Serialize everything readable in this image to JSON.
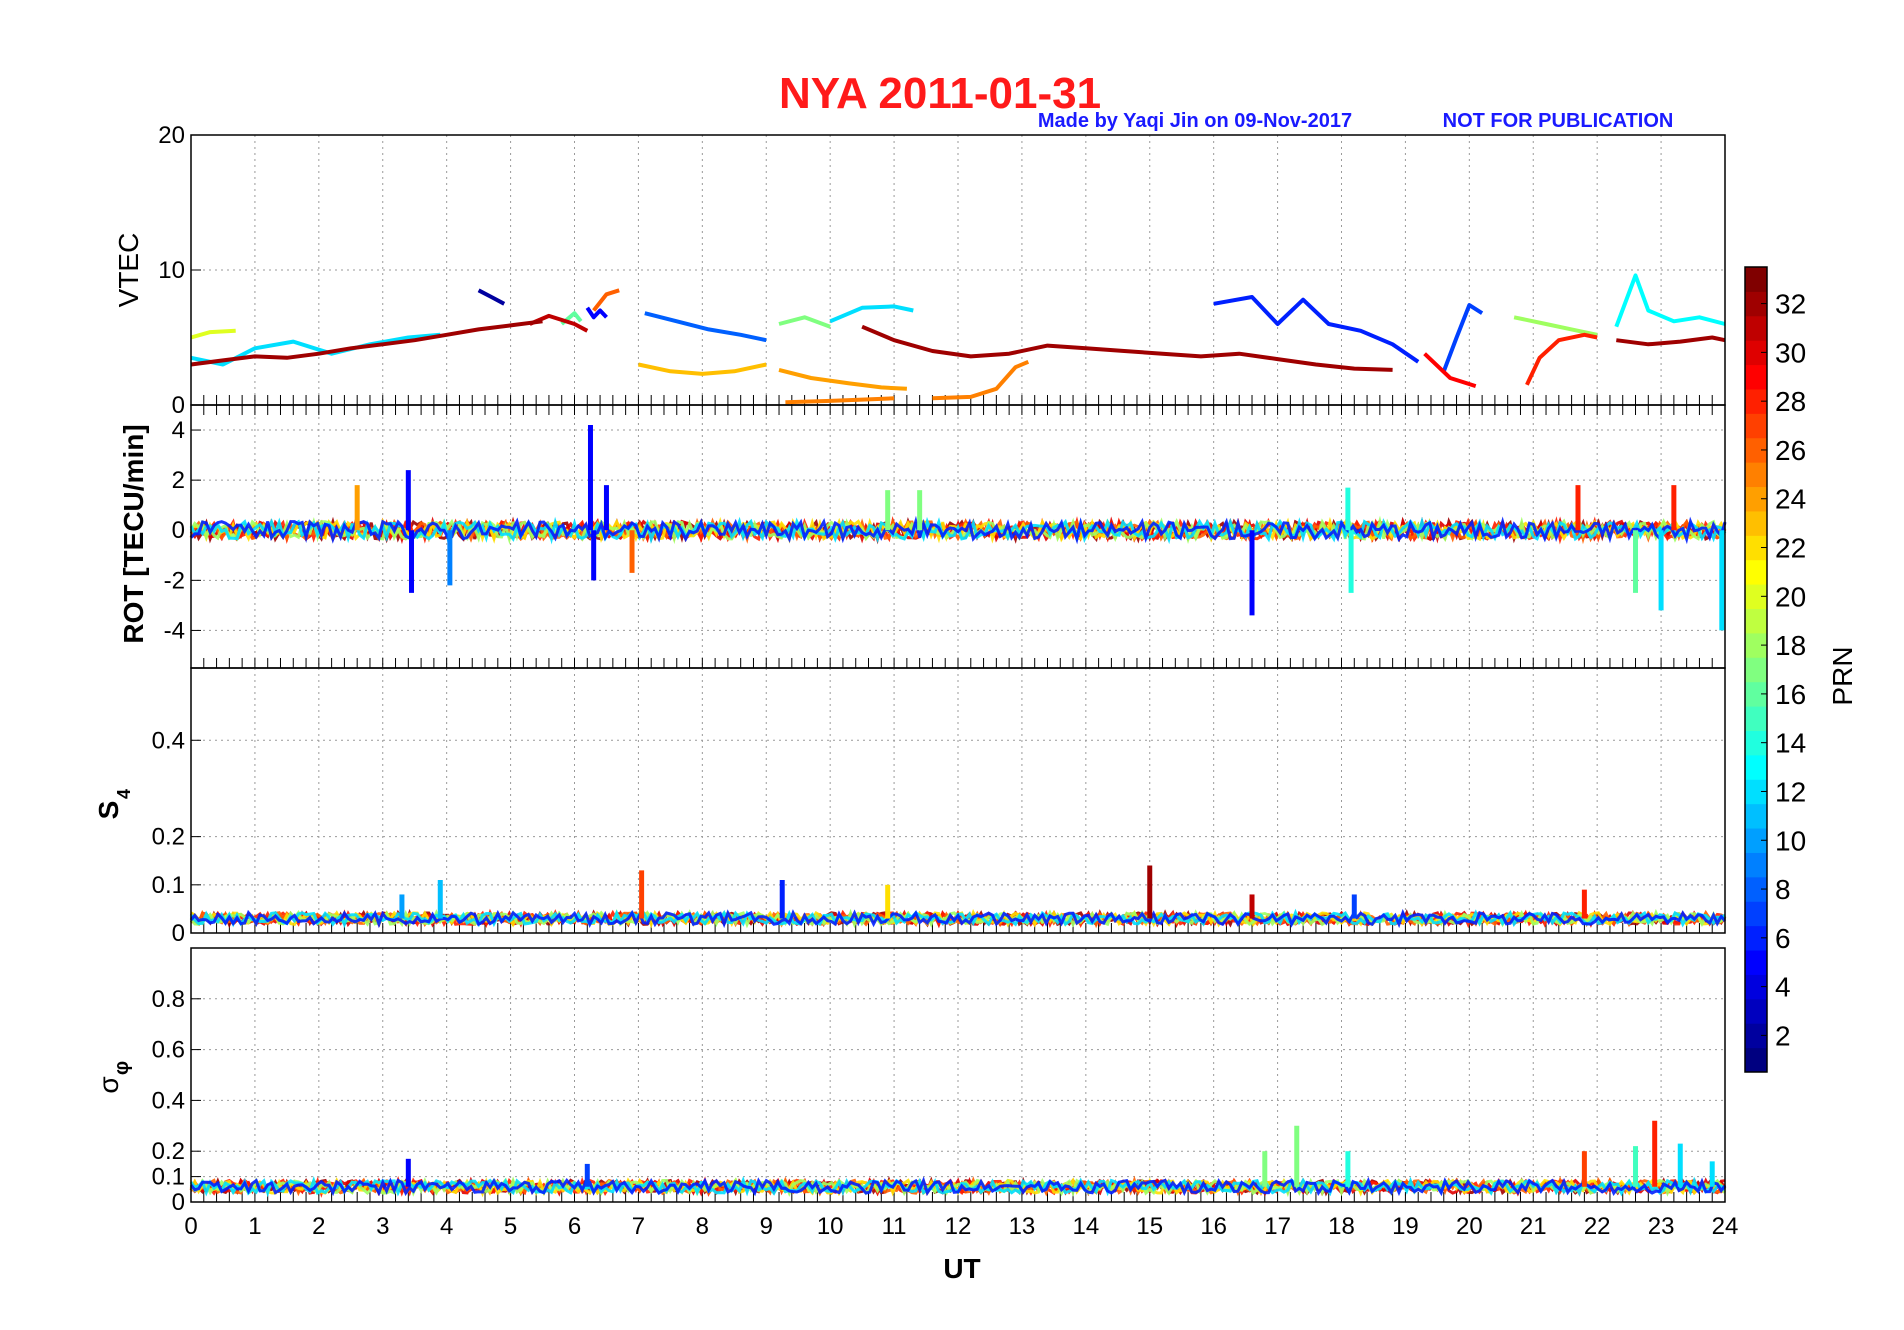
{
  "title": "NYA   2011-01-31",
  "credit": "Made by Yaqi Jin on 09-Nov-2017",
  "notice": "NOT FOR PUBLICATION",
  "colors": {
    "title": "#ff1a1a",
    "credit": "#1a1aff"
  },
  "chart_data": {
    "type": "line",
    "x": {
      "label": "UT",
      "range": [
        0,
        24
      ],
      "ticks": [
        "0",
        "1",
        "2",
        "3",
        "4",
        "5",
        "6",
        "7",
        "8",
        "9",
        "10",
        "11",
        "12",
        "13",
        "14",
        "15",
        "16",
        "17",
        "18",
        "19",
        "20",
        "21",
        "22",
        "23",
        "24"
      ]
    },
    "grid": true,
    "colorbar": {
      "label": "PRN",
      "range": [
        1,
        33
      ],
      "ticks": [
        "2",
        "4",
        "6",
        "8",
        "10",
        "12",
        "14",
        "16",
        "18",
        "20",
        "22",
        "24",
        "26",
        "28",
        "30",
        "32"
      ],
      "colormap": "jet"
    },
    "panels": [
      {
        "ylabel": "VTEC",
        "ylim": [
          0,
          20
        ],
        "yticks": [
          "0",
          "10",
          "20"
        ],
        "series": [
          {
            "prn": 2,
            "points": [
              [
                4.5,
                8.5
              ],
              [
                4.7,
                8.0
              ],
              [
                4.9,
                7.5
              ]
            ]
          },
          {
            "prn": 5,
            "points": [
              [
                6.2,
                7.2
              ],
              [
                6.3,
                6.5
              ],
              [
                6.4,
                7.0
              ],
              [
                6.5,
                6.5
              ]
            ]
          },
          {
            "prn": 6,
            "points": [
              [
                16,
                7.5
              ],
              [
                16.6,
                8.0
              ],
              [
                17,
                6.0
              ],
              [
                17.4,
                7.8
              ],
              [
                17.8,
                6.0
              ],
              [
                18.3,
                5.5
              ],
              [
                18.8,
                4.5
              ],
              [
                19.2,
                3.2
              ]
            ]
          },
          {
            "prn": 7,
            "points": [
              [
                19.6,
                2.5
              ],
              [
                19.8,
                5.0
              ],
              [
                20.0,
                7.4
              ],
              [
                20.2,
                6.8
              ]
            ]
          },
          {
            "prn": 8,
            "points": [
              [
                7.1,
                6.8
              ],
              [
                7.6,
                6.2
              ],
              [
                8.1,
                5.6
              ],
              [
                8.6,
                5.2
              ],
              [
                9.0,
                4.8
              ]
            ]
          },
          {
            "prn": 12,
            "points": [
              [
                10.0,
                6.2
              ],
              [
                10.5,
                7.2
              ],
              [
                11.0,
                7.3
              ],
              [
                11.3,
                7.0
              ]
            ]
          },
          {
            "prn": 12,
            "points": [
              [
                0.0,
                3.5
              ],
              [
                0.5,
                3.0
              ],
              [
                1.0,
                4.2
              ],
              [
                1.6,
                4.7
              ],
              [
                2.2,
                3.8
              ],
              [
                2.8,
                4.5
              ],
              [
                3.4,
                5.0
              ],
              [
                3.9,
                5.2
              ]
            ]
          },
          {
            "prn": 13,
            "points": [
              [
                22.3,
                5.8
              ],
              [
                22.6,
                9.6
              ],
              [
                22.8,
                7.0
              ],
              [
                23.2,
                6.2
              ],
              [
                23.6,
                6.5
              ],
              [
                24.0,
                6.0
              ]
            ]
          },
          {
            "prn": 16,
            "points": [
              [
                5.8,
                6.0
              ],
              [
                6.0,
                6.8
              ],
              [
                6.1,
                6.2
              ]
            ]
          },
          {
            "prn": 17,
            "points": [
              [
                9.2,
                6.0
              ],
              [
                9.6,
                6.5
              ],
              [
                10.0,
                5.8
              ]
            ]
          },
          {
            "prn": 18,
            "points": [
              [
                20.7,
                6.5
              ],
              [
                21.2,
                6.0
              ],
              [
                21.6,
                5.6
              ],
              [
                22.0,
                5.2
              ]
            ]
          },
          {
            "prn": 20,
            "points": [
              [
                0.0,
                5.0
              ],
              [
                0.3,
                5.4
              ],
              [
                0.7,
                5.5
              ]
            ]
          },
          {
            "prn": 23,
            "points": [
              [
                7.0,
                3.0
              ],
              [
                7.5,
                2.5
              ],
              [
                8.0,
                2.3
              ],
              [
                8.5,
                2.5
              ],
              [
                9.0,
                3.0
              ]
            ]
          },
          {
            "prn": 24,
            "points": [
              [
                9.2,
                2.6
              ],
              [
                9.7,
                2.0
              ],
              [
                10.3,
                1.6
              ],
              [
                10.8,
                1.3
              ],
              [
                11.2,
                1.2
              ]
            ]
          },
          {
            "prn": 25,
            "points": [
              [
                9.3,
                0.2
              ],
              [
                10.0,
                0.3
              ],
              [
                10.5,
                0.4
              ],
              [
                11.0,
                0.5
              ]
            ]
          },
          {
            "prn": 25,
            "points": [
              [
                11.6,
                0.5
              ],
              [
                12.2,
                0.6
              ],
              [
                12.6,
                1.2
              ],
              [
                12.9,
                2.8
              ],
              [
                13.1,
                3.2
              ]
            ]
          },
          {
            "prn": 26,
            "points": [
              [
                6.3,
                7.0
              ],
              [
                6.5,
                8.2
              ],
              [
                6.7,
                8.5
              ]
            ]
          },
          {
            "prn": 28,
            "points": [
              [
                20.9,
                1.5
              ],
              [
                21.1,
                3.5
              ],
              [
                21.4,
                4.8
              ],
              [
                21.8,
                5.2
              ],
              [
                22.0,
                5.0
              ]
            ]
          },
          {
            "prn": 29,
            "points": [
              [
                19.3,
                3.8
              ],
              [
                19.7,
                2.0
              ],
              [
                20.1,
                1.4
              ]
            ]
          },
          {
            "prn": 31,
            "points": [
              [
                5.3,
                6.0
              ],
              [
                5.6,
                6.6
              ],
              [
                6.0,
                6.0
              ],
              [
                6.2,
                5.5
              ]
            ]
          },
          {
            "prn": 32,
            "points": [
              [
                0.0,
                3.0
              ],
              [
                0.5,
                3.3
              ],
              [
                1.0,
                3.6
              ],
              [
                1.5,
                3.5
              ],
              [
                2.0,
                3.8
              ],
              [
                2.5,
                4.2
              ],
              [
                3.0,
                4.5
              ],
              [
                3.5,
                4.8
              ],
              [
                4.0,
                5.2
              ],
              [
                4.5,
                5.6
              ],
              [
                5.0,
                5.9
              ],
              [
                5.5,
                6.2
              ]
            ]
          },
          {
            "prn": 32,
            "points": [
              [
                10.5,
                5.8
              ],
              [
                11.0,
                4.8
              ],
              [
                11.6,
                4.0
              ],
              [
                12.2,
                3.6
              ],
              [
                12.8,
                3.8
              ],
              [
                13.4,
                4.4
              ],
              [
                14.0,
                4.2
              ],
              [
                14.6,
                4.0
              ],
              [
                15.2,
                3.8
              ],
              [
                15.8,
                3.6
              ],
              [
                16.4,
                3.8
              ],
              [
                17.0,
                3.4
              ],
              [
                17.6,
                3.0
              ],
              [
                18.2,
                2.7
              ],
              [
                18.8,
                2.6
              ]
            ]
          },
          {
            "prn": 32,
            "points": [
              [
                22.3,
                4.8
              ],
              [
                22.8,
                4.5
              ],
              [
                23.3,
                4.7
              ],
              [
                23.8,
                5.0
              ],
              [
                24.0,
                4.8
              ]
            ]
          }
        ]
      },
      {
        "ylabel": "ROT [TECU/min]",
        "ylim": [
          -5.5,
          5
        ],
        "yticks": [
          "-4",
          "-2",
          "0",
          "2",
          "4"
        ],
        "spikes": [
          {
            "x": 3.4,
            "value": 2.4,
            "prn": 5
          },
          {
            "x": 3.45,
            "value": -2.5,
            "prn": 5
          },
          {
            "x": 4.05,
            "value": -2.2,
            "prn": 9
          },
          {
            "x": 6.25,
            "value": 4.2,
            "prn": 5
          },
          {
            "x": 6.3,
            "value": -2.0,
            "prn": 5
          },
          {
            "x": 6.5,
            "value": 1.8,
            "prn": 5
          },
          {
            "x": 6.9,
            "value": -1.7,
            "prn": 26
          },
          {
            "x": 2.6,
            "value": 1.8,
            "prn": 24
          },
          {
            "x": 10.9,
            "value": 1.6,
            "prn": 17
          },
          {
            "x": 11.4,
            "value": 1.6,
            "prn": 17
          },
          {
            "x": 16.6,
            "value": -3.4,
            "prn": 5
          },
          {
            "x": 18.1,
            "value": 1.7,
            "prn": 14
          },
          {
            "x": 18.15,
            "value": -2.5,
            "prn": 14
          },
          {
            "x": 21.7,
            "value": 1.8,
            "prn": 28
          },
          {
            "x": 22.6,
            "value": -2.5,
            "prn": 16
          },
          {
            "x": 23.0,
            "value": -3.2,
            "prn": 12
          },
          {
            "x": 23.2,
            "value": 1.8,
            "prn": 28
          },
          {
            "x": 23.95,
            "value": -4.0,
            "prn": 12
          }
        ]
      },
      {
        "ylabel": "S4",
        "ylim": [
          0,
          0.55
        ],
        "yticks": [
          "0",
          "0.1",
          "0.2",
          "0.4"
        ],
        "baseline": 0.03,
        "spikes": [
          {
            "x": 3.3,
            "value": 0.08,
            "prn": 10
          },
          {
            "x": 3.9,
            "value": 0.11,
            "prn": 11
          },
          {
            "x": 7.05,
            "value": 0.13,
            "prn": 27
          },
          {
            "x": 9.25,
            "value": 0.11,
            "prn": 6
          },
          {
            "x": 10.9,
            "value": 0.1,
            "prn": 22
          },
          {
            "x": 15.0,
            "value": 0.14,
            "prn": 32
          },
          {
            "x": 16.6,
            "value": 0.08,
            "prn": 31
          },
          {
            "x": 18.2,
            "value": 0.08,
            "prn": 7
          },
          {
            "x": 21.8,
            "value": 0.09,
            "prn": 28
          }
        ]
      },
      {
        "ylabel": "σφ",
        "ylim": [
          0,
          1.0
        ],
        "yticks": [
          "0",
          "0.1",
          "0.2",
          "0.4",
          "0.6",
          "0.8"
        ],
        "baseline": 0.06,
        "spikes": [
          {
            "x": 3.4,
            "value": 0.17,
            "prn": 5
          },
          {
            "x": 6.2,
            "value": 0.15,
            "prn": 7
          },
          {
            "x": 16.8,
            "value": 0.2,
            "prn": 17
          },
          {
            "x": 17.3,
            "value": 0.3,
            "prn": 17
          },
          {
            "x": 18.1,
            "value": 0.2,
            "prn": 14
          },
          {
            "x": 21.8,
            "value": 0.2,
            "prn": 27
          },
          {
            "x": 22.6,
            "value": 0.22,
            "prn": 15
          },
          {
            "x": 22.9,
            "value": 0.32,
            "prn": 28
          },
          {
            "x": 23.3,
            "value": 0.23,
            "prn": 12
          },
          {
            "x": 23.8,
            "value": 0.16,
            "prn": 12
          }
        ]
      }
    ]
  }
}
